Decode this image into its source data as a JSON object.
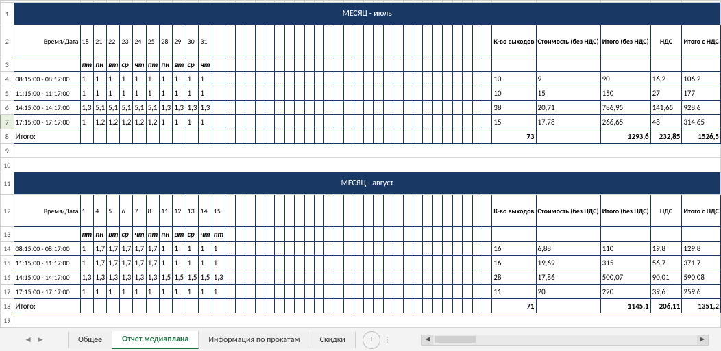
{
  "tabs": {
    "items": [
      "Общее",
      "Отчет медиаплана",
      "Информация по прокатам",
      "Скидки"
    ],
    "active_index": 1
  },
  "row_headers": [
    "1",
    "2",
    "3",
    "4",
    "5",
    "6",
    "7",
    "8",
    "9",
    "10",
    "11",
    "12",
    "13",
    "14",
    "15",
    "16",
    "17",
    "18",
    "19"
  ],
  "selected_row_index": 6,
  "labels": {
    "time_date": "Время/Дата",
    "total": "Итого:",
    "count": "К-во выходов",
    "cost": "Стоимость (без НДС)",
    "sum_no_vat": "Итого (без НДС)",
    "vat": "НДС",
    "sum_vat": "Итого с НДС",
    "month_prefix": "МЕСЯЦ - "
  },
  "months": [
    {
      "name": "июль",
      "days": [
        "18",
        "21",
        "22",
        "23",
        "24",
        "25",
        "28",
        "29",
        "30",
        "31"
      ],
      "weekdays": [
        "пт",
        "пн",
        "вт",
        "ср",
        "чт",
        "пт",
        "пн",
        "вт",
        "ср",
        "чт"
      ],
      "rows": [
        {
          "time": "08:15:00 - 08:17:00",
          "vals": [
            "1",
            "1",
            "1",
            "1",
            "1",
            "1",
            "1",
            "1",
            "1",
            "1"
          ],
          "cnt": "10",
          "cost": "9",
          "sum": "90",
          "vat": "16,2",
          "sumv": "106,2"
        },
        {
          "time": "11:15:00 - 11:17:00",
          "vals": [
            "1",
            "1",
            "1",
            "1",
            "1",
            "1",
            "1",
            "1",
            "1",
            "1"
          ],
          "cnt": "10",
          "cost": "15",
          "sum": "150",
          "vat": "27",
          "sumv": "177"
        },
        {
          "time": "14:15:00 - 14:17:00",
          "vals": [
            "1,3",
            "5,1",
            "5,1",
            "5,1",
            "5,1",
            "5,1",
            "1,3",
            "1,3",
            "1,3",
            "1,3"
          ],
          "cnt": "38",
          "cost": "20,71",
          "sum": "786,95",
          "vat": "141,65",
          "sumv": "928,6"
        },
        {
          "time": "17:15:00 - 17:17:00",
          "vals": [
            "1",
            "1,2",
            "1,2",
            "1,2",
            "1,2",
            "1,2",
            "1",
            "1",
            "1",
            "1"
          ],
          "cnt": "15",
          "cost": "17,78",
          "sum": "266,65",
          "vat": "48",
          "sumv": "314,65"
        }
      ],
      "totals": {
        "cnt": "73",
        "sum": "1293,6",
        "vat": "232,85",
        "sumv": "1526,5"
      }
    },
    {
      "name": "август",
      "days": [
        "1",
        "4",
        "5",
        "6",
        "7",
        "8",
        "11",
        "12",
        "13",
        "14",
        "15"
      ],
      "weekdays": [
        "пт",
        "пн",
        "вт",
        "ср",
        "чт",
        "пт",
        "пн",
        "вт",
        "ср",
        "чт",
        "пт"
      ],
      "rows": [
        {
          "time": "08:15:00 - 08:17:00",
          "vals": [
            "1",
            "1,7",
            "1,7",
            "1,7",
            "1,7",
            "1,7",
            "1",
            "1",
            "1",
            "1",
            "1"
          ],
          "cnt": "16",
          "cost": "6,88",
          "sum": "110",
          "vat": "19,8",
          "sumv": "129,8"
        },
        {
          "time": "11:15:00 - 11:17:00",
          "vals": [
            "1",
            "1,7",
            "1,7",
            "1,7",
            "1,7",
            "1,7",
            "1",
            "1",
            "1",
            "1",
            "1"
          ],
          "cnt": "16",
          "cost": "19,69",
          "sum": "315",
          "vat": "56,7",
          "sumv": "371,7"
        },
        {
          "time": "14:15:00 - 14:17:00",
          "vals": [
            "1,3",
            "1,3",
            "1,3",
            "1,3",
            "1,3",
            "1,3",
            "1,5",
            "1,5",
            "1,5",
            "1,5",
            "1,3"
          ],
          "cnt": "28",
          "cost": "17,86",
          "sum": "500,07",
          "vat": "90,01",
          "sumv": "590,08"
        },
        {
          "time": "17:15:00 - 17:17:00",
          "vals": [
            "1",
            "1",
            "1",
            "1",
            "1",
            "1",
            "1",
            "1",
            "1",
            "1",
            "1"
          ],
          "cnt": "11",
          "cost": "20",
          "sum": "220",
          "vat": "39,6",
          "sumv": "259,6"
        }
      ],
      "totals": {
        "cnt": "71",
        "sum": "1145,1",
        "vat": "206,11",
        "sumv": "1351,2"
      }
    }
  ],
  "chart_data": [
    {
      "type": "table",
      "title": "МЕСЯЦ - июль",
      "columns": [
        "Время/Дата",
        "18",
        "21",
        "22",
        "23",
        "24",
        "25",
        "28",
        "29",
        "30",
        "31",
        "К-во выходов",
        "Стоимость (без НДС)",
        "Итого (без НДС)",
        "НДС",
        "Итого с НДС"
      ],
      "rows": [
        [
          "08:15:00 - 08:17:00",
          "1",
          "1",
          "1",
          "1",
          "1",
          "1",
          "1",
          "1",
          "1",
          "1",
          "10",
          "9",
          "90",
          "16,2",
          "106,2"
        ],
        [
          "11:15:00 - 11:17:00",
          "1",
          "1",
          "1",
          "1",
          "1",
          "1",
          "1",
          "1",
          "1",
          "1",
          "10",
          "15",
          "150",
          "27",
          "177"
        ],
        [
          "14:15:00 - 14:17:00",
          "1,3",
          "5,1",
          "5,1",
          "5,1",
          "5,1",
          "5,1",
          "1,3",
          "1,3",
          "1,3",
          "1,3",
          "38",
          "20,71",
          "786,95",
          "141,65",
          "928,6"
        ],
        [
          "17:15:00 - 17:17:00",
          "1",
          "1,2",
          "1,2",
          "1,2",
          "1,2",
          "1,2",
          "1",
          "1",
          "1",
          "1",
          "15",
          "17,78",
          "266,65",
          "48",
          "314,65"
        ],
        [
          "Итого:",
          "",
          "",
          "",
          "",
          "",
          "",
          "",
          "",
          "",
          "",
          "73",
          "",
          "1293,6",
          "232,85",
          "1526,5"
        ]
      ]
    },
    {
      "type": "table",
      "title": "МЕСЯЦ - август",
      "columns": [
        "Время/Дата",
        "1",
        "4",
        "5",
        "6",
        "7",
        "8",
        "11",
        "12",
        "13",
        "14",
        "15",
        "К-во выходов",
        "Стоимость (без НДС)",
        "Итого (без НДС)",
        "НДС",
        "Итого с НДС"
      ],
      "rows": [
        [
          "08:15:00 - 08:17:00",
          "1",
          "1,7",
          "1,7",
          "1,7",
          "1,7",
          "1,7",
          "1",
          "1",
          "1",
          "1",
          "1",
          "16",
          "6,88",
          "110",
          "19,8",
          "129,8"
        ],
        [
          "11:15:00 - 11:17:00",
          "1",
          "1,7",
          "1,7",
          "1,7",
          "1,7",
          "1,7",
          "1",
          "1",
          "1",
          "1",
          "1",
          "16",
          "19,69",
          "315",
          "56,7",
          "371,7"
        ],
        [
          "14:15:00 - 14:17:00",
          "1,3",
          "1,3",
          "1,3",
          "1,3",
          "1,3",
          "1,3",
          "1,5",
          "1,5",
          "1,5",
          "1,5",
          "1,3",
          "28",
          "17,86",
          "500,07",
          "90,01",
          "590,08"
        ],
        [
          "17:15:00 - 17:17:00",
          "1",
          "1",
          "1",
          "1",
          "1",
          "1",
          "1",
          "1",
          "1",
          "1",
          "1",
          "11",
          "20",
          "220",
          "39,6",
          "259,6"
        ],
        [
          "Итого:",
          "",
          "",
          "",
          "",
          "",
          "",
          "",
          "",
          "",
          "",
          "",
          "71",
          "",
          "1145,1",
          "206,11",
          "1351,2"
        ]
      ]
    }
  ]
}
